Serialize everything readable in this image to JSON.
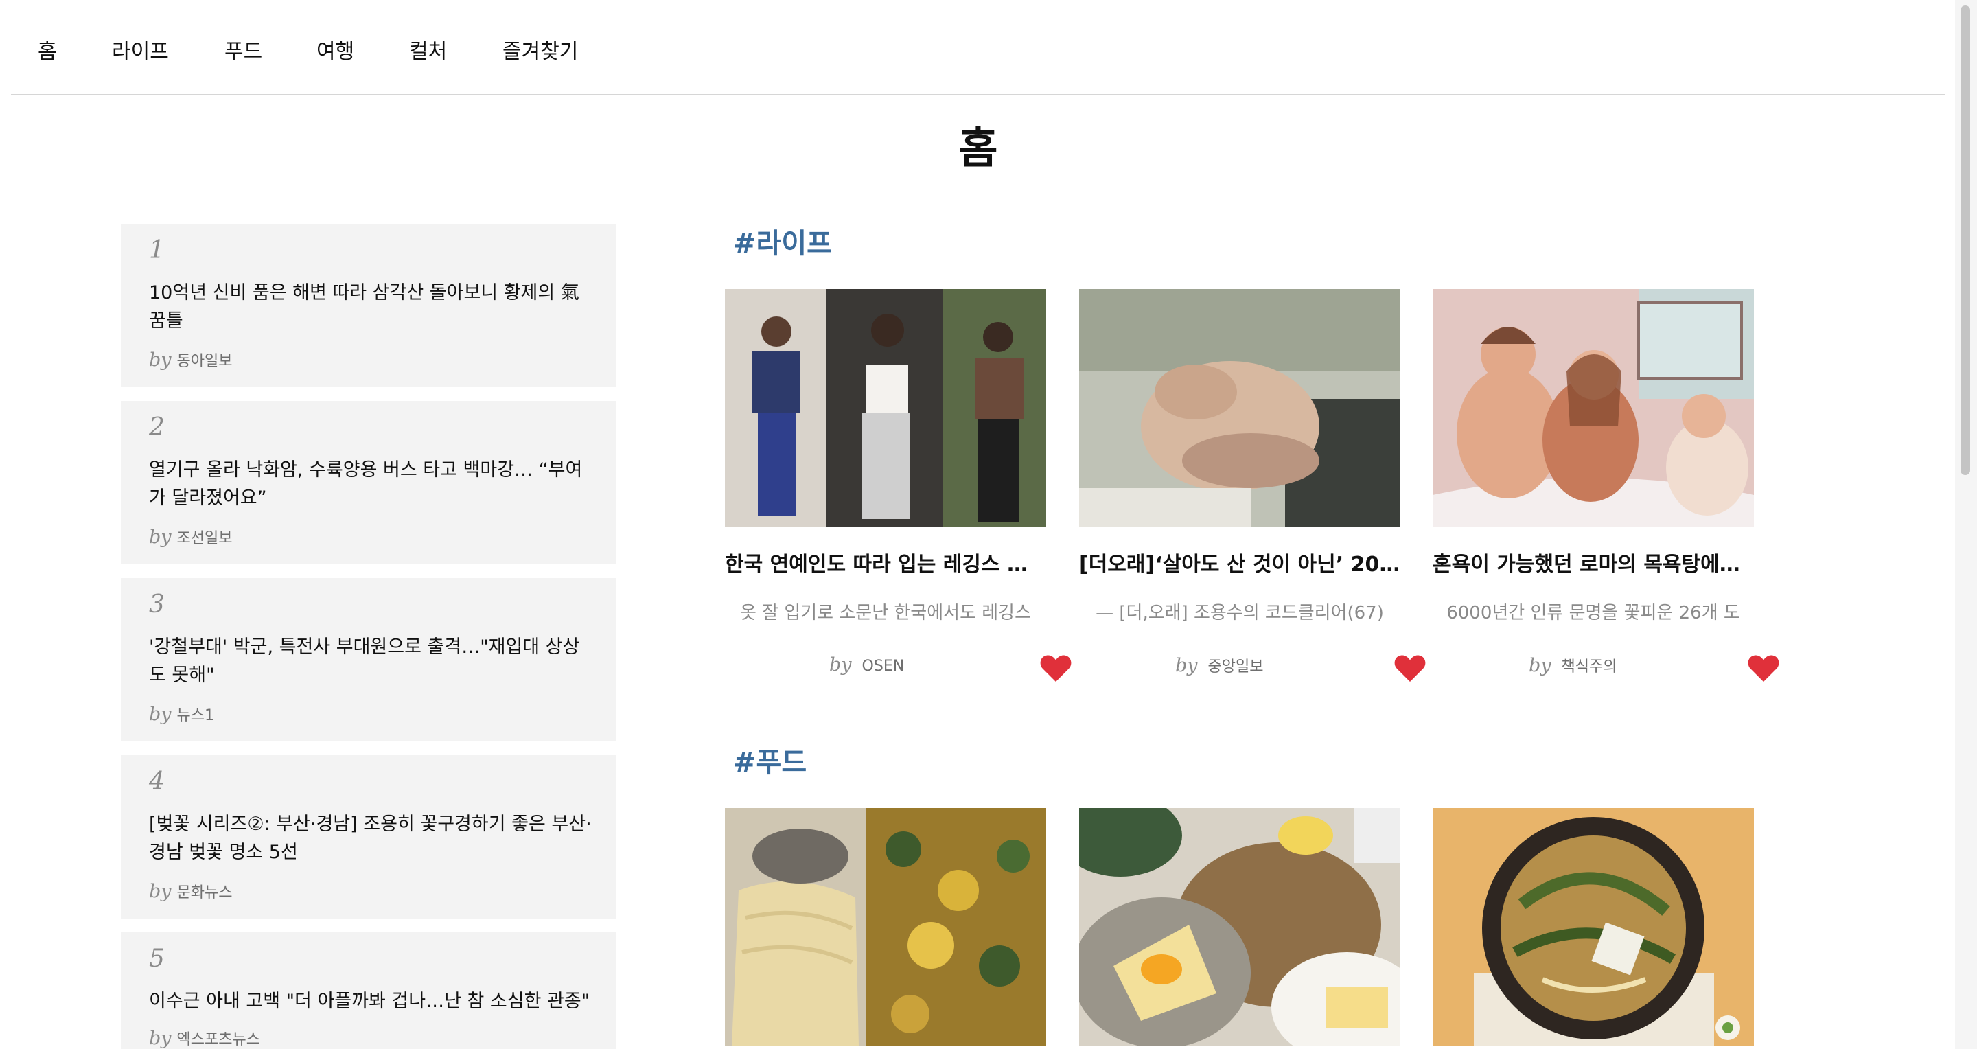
{
  "nav": {
    "items": [
      "홈",
      "라이프",
      "푸드",
      "여행",
      "컬처",
      "즐겨찾기"
    ]
  },
  "page": {
    "title": "홈"
  },
  "ranking": [
    {
      "num": "1",
      "title": "10억년 신비 품은 해변 따라 삼각산 돌아보니 황제의 氣 꿈틀",
      "by": "by",
      "source": "동아일보"
    },
    {
      "num": "2",
      "title": "열기구 올라 낙화암, 수륙양용 버스 타고 백마강… “부여가 달라졌어요”",
      "by": "by",
      "source": "조선일보"
    },
    {
      "num": "3",
      "title": "'강철부대' 박군, 특전사 부대원으로 출격…\"재입대 상상도 못해\"",
      "by": "by",
      "source": "뉴스1"
    },
    {
      "num": "4",
      "title": "[벚꽃 시리즈②: 부산·경남] 조용히 꽃구경하기 좋은 부산·경남 벚꽃 명소 5선",
      "by": "by",
      "source": "문화뉴스"
    },
    {
      "num": "5",
      "title": "이수근 아내 고백 \"더 아플까봐 겁나…난 참 소심한 관종\"",
      "by": "by",
      "source": "엑스포츠뉴스"
    }
  ],
  "sections": [
    {
      "tag": "#라이프",
      "cards": [
        {
          "title": "한국 연예인도 따라 입는 레깅스 패…",
          "desc": "옷 잘 입기로 소문난 한국에서도 레깅스",
          "by": "by",
          "source": "OSEN",
          "image": "leggings-fashion-photo"
        },
        {
          "title": "[더오래]‘살아도 산 것이 아닌’ 20…",
          "desc": "— [더,오래] 조용수의 코드클리어(67)",
          "by": "by",
          "source": "중앙일보",
          "image": "clasped-hands-photo"
        },
        {
          "title": "혼욕이 가능했던 로마의 목욕탕에…",
          "desc": "6000년간 인류 문명을 꽃피운 26개 도",
          "by": "by",
          "source": "책식주의",
          "image": "roman-bath-illustration"
        }
      ]
    },
    {
      "tag": "#푸드",
      "cards": [
        {
          "image": "pasta-and-omelette-photo"
        },
        {
          "image": "crepe-plate-photo"
        },
        {
          "image": "noodle-soup-bowl-photo"
        }
      ]
    }
  ],
  "colors": {
    "section_tag": "#3a6b9b",
    "heart": "#e0303a",
    "rank_bg": "#f3f3f3"
  }
}
